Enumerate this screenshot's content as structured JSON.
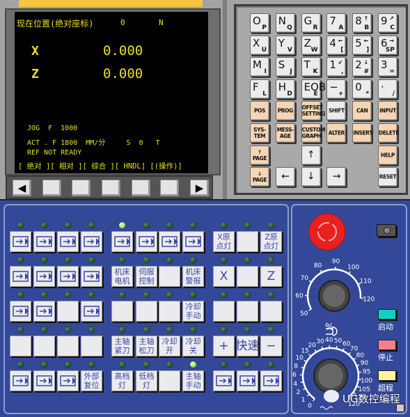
{
  "screen": {
    "title": "现在位置(绝对座标)",
    "o_label": "0",
    "n_label": "N",
    "x_axis": "X",
    "x_value": "0.000",
    "z_axis": "Z",
    "z_value": "0.000",
    "jog_line": "JOG  F  1000",
    "act_line": "ACT . F 1800  MM/分     S  0   T",
    "ref_line": "REF NOT READY",
    "softkeys": "[ 绝对 ][ 相对 ][ 综合 ][ HNDL] [(操作)]",
    "text_color": "#e6e020"
  },
  "softbar": {
    "left": "◀",
    "right": "▶"
  },
  "keypad": {
    "rows": [
      [
        {
          "m": "O",
          "s": "P"
        },
        {
          "m": "N",
          "s": "Q"
        },
        {
          "m": "G",
          "s": "R"
        },
        {
          "m": "7",
          "s": "A"
        },
        {
          "m": "8",
          "sp": "↑",
          "s": "B"
        },
        {
          "m": "9",
          "sp": "↗",
          "s": "C"
        }
      ],
      [
        {
          "m": "X",
          "s": "U"
        },
        {
          "m": "Y",
          "s": "V"
        },
        {
          "m": "Z",
          "s": "W"
        },
        {
          "m": "4",
          "sp": "←",
          "s": "["
        },
        {
          "m": "5",
          "sp": "⇜",
          "s": "]"
        },
        {
          "m": "6",
          "sp": "→",
          "s": "SP"
        }
      ],
      [
        {
          "m": "M",
          "s": "I"
        },
        {
          "m": "S",
          "s": "J"
        },
        {
          "m": "T",
          "s": "K"
        },
        {
          "m": "1",
          "sp": "↙",
          "s": ","
        },
        {
          "m": "2",
          "sp": "↓",
          "s": "#"
        },
        {
          "m": "3",
          "s": "="
        }
      ],
      [
        {
          "m": "F",
          "s": "L"
        },
        {
          "m": "H",
          "s": "D"
        },
        {
          "m": "EOB",
          "s": "E"
        },
        {
          "m": "−",
          "s": "+"
        },
        {
          "m": "0",
          "s": "*"
        },
        {
          "m": "·",
          "s": "/"
        }
      ],
      [
        {
          "c": "POS",
          "o": true
        },
        {
          "c": "PROG",
          "o": true
        },
        {
          "c": "OFFSET\nSETTING",
          "o": true
        },
        {
          "c": "SHIFT"
        },
        {
          "c": "CAN",
          "o": true
        },
        {
          "c": "INPUT",
          "o": true
        }
      ],
      [
        {
          "c": "SYS-\nTEM",
          "o": true
        },
        {
          "c": "MESS-\nAGE",
          "o": true
        },
        {
          "c": "CUSTOM\nGRAPH",
          "o": true
        },
        {
          "c": "ALTER",
          "o": true
        },
        {
          "c": "INSERT",
          "o": true
        },
        {
          "c": "DELETE",
          "o": true
        }
      ],
      [
        {
          "c": "↑\nPAGE",
          "o": true
        },
        null,
        {
          "c": "↑",
          "a": true
        },
        null,
        null,
        {
          "c": "HELP",
          "o": true
        }
      ],
      [
        {
          "c": "↓\nPAGE",
          "o": true
        },
        {
          "c": "←",
          "a": true
        },
        {
          "c": "↓",
          "a": true
        },
        {
          "c": "→",
          "a": true
        },
        null,
        {
          "c": "RESET"
        }
      ]
    ]
  },
  "panel": {
    "rows": [
      [
        {
          "icon": "edit-mode-icon"
        },
        {
          "icon": "mdi-mode-icon"
        },
        {
          "icon": "dnc-mode-icon"
        },
        {
          "icon": "auto-mode-icon"
        },
        {
          "icon": "reference-return-icon",
          "led": true
        },
        {
          "icon": "handwheel-mode-icon"
        },
        {
          "icon": "jog-mode-icon"
        },
        {
          "icon": "teach-mode-icon"
        },
        {
          "t": "X原\n点灯"
        },
        {
          "t": ""
        },
        {
          "t": "Z原\n点灯"
        }
      ],
      [
        {
          "icon": "single-block-icon"
        },
        {
          "icon": "block-skip-icon"
        },
        {
          "icon": "optional-stop-icon"
        },
        {
          "icon": "handwheel-interrupt-icon"
        },
        {
          "t": "机床\n电机"
        },
        {
          "t": "伺服\n控制"
        },
        {
          "t": ""
        },
        {
          "t": "机床\n警报"
        },
        {
          "t": "X"
        },
        {
          "t": ""
        },
        {
          "t": "Z"
        }
      ],
      [
        {
          "icon": "machine-lock-icon"
        },
        {
          "icon": "dry-run-icon"
        },
        {
          "t": ""
        },
        {
          "icon": "program-restart-icon"
        },
        {
          "t": ""
        },
        {
          "t": ""
        },
        {
          "t": ""
        },
        {
          "t": "冷却\n手动"
        },
        {
          "t": ""
        },
        {
          "t": ""
        },
        {
          "t": ""
        }
      ],
      [
        {
          "t": ""
        },
        {
          "t": ""
        },
        {
          "t": ""
        },
        {
          "t": ""
        },
        {
          "t": "主轴\n紧刀"
        },
        {
          "t": "主轴\n松刀"
        },
        {
          "t": "冷却\n开"
        },
        {
          "t": "冷却\n关"
        },
        {
          "t": "+"
        },
        {
          "t": "快速"
        },
        {
          "t": "−"
        }
      ],
      [
        {
          "icon": "cycle-start-icon"
        },
        {
          "icon": "feed-hold-icon"
        },
        {
          "icon": "program-stop-icon"
        },
        {
          "t": "外部\n复位"
        },
        {
          "t": "高档\n灯"
        },
        {
          "t": "低档\n灯"
        },
        {
          "t": ""
        },
        {
          "t": "主轴\n手动",
          "led": true
        },
        {
          "icon": "spindle-cw-icon"
        },
        {
          "icon": "spindle-stop-icon"
        },
        {
          "icon": "spindle-ccw-icon"
        }
      ]
    ]
  },
  "right_panel": {
    "emergency_stop_color": "#e82020",
    "spindle_dial": {
      "ticks": [
        "50",
        "60",
        "70",
        "80",
        "90",
        "100",
        "110",
        "120"
      ],
      "unit": "%"
    },
    "feed_dial": {
      "ticks": [
        "0",
        "1",
        "2",
        "4",
        "6",
        "8",
        "10",
        "15",
        "20",
        "30",
        "40",
        "50",
        "60",
        "70",
        "80",
        "90",
        "95",
        "100",
        "105",
        "110",
        "120"
      ]
    },
    "start_label": "启动",
    "start_color": "#10d0c0",
    "stop_label": "停止",
    "stop_color": "#f08090",
    "overtravel_label": "超程",
    "overtravel_color": "#fff59a",
    "watermark": "UG数控编程"
  }
}
